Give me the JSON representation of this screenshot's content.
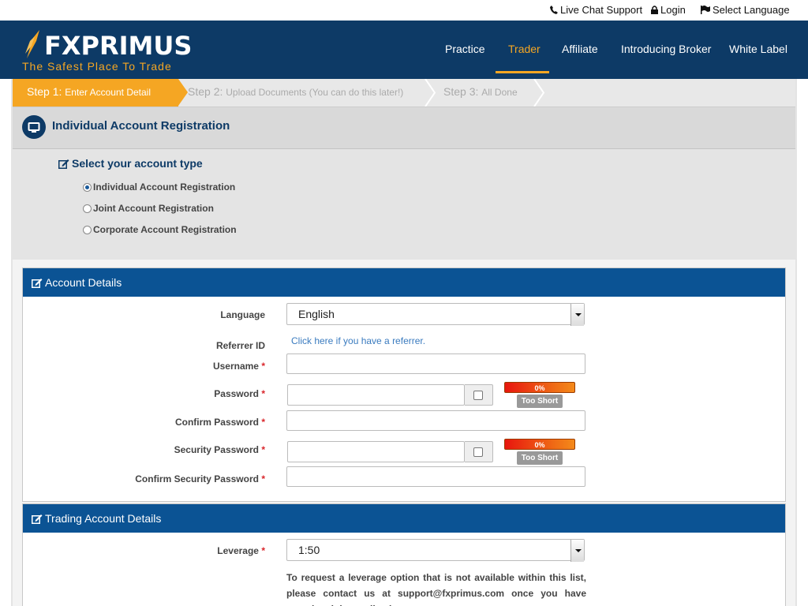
{
  "topbar": {
    "live_chat": "Live Chat Support",
    "login": "Login",
    "select_language": "Select Language"
  },
  "brand": {
    "name": "FXPRIMUS",
    "tagline": "The Safest Place To Trade",
    "accent_color": "#f5a623",
    "primary_color": "#0d3a66"
  },
  "nav": {
    "items": [
      "Practice",
      "Trader",
      "Affiliate",
      "Introducing Broker",
      "White Label"
    ],
    "active": "Trader"
  },
  "steps": [
    {
      "num": "Step 1:",
      "label": "Enter Account Detail",
      "state": "active"
    },
    {
      "num": "Step 2:",
      "label": "Upload Documents (You can do this later!)",
      "state": "pending"
    },
    {
      "num": "Step 3:",
      "label": "All Done",
      "state": "pending"
    }
  ],
  "section": {
    "title": "Individual Account Registration",
    "icon": "monitor-icon"
  },
  "account_type": {
    "title": "Select your account type",
    "options": [
      {
        "label": "Individual Account Registration",
        "checked": true
      },
      {
        "label": "Joint Account Registration",
        "checked": false
      },
      {
        "label": "Corporate Account Registration",
        "checked": false
      }
    ]
  },
  "account_details": {
    "title": "Account Details",
    "language_label": "Language",
    "language_value": "English",
    "referrer_label": "Referrer ID",
    "referrer_link": "Click here if you have a referrer.",
    "username_label": "Username",
    "password_label": "Password",
    "confirm_password_label": "Confirm Password",
    "security_password_label": "Security Password",
    "confirm_security_password_label": "Confirm Security Password",
    "required_mark": "*",
    "strength_value": "0%",
    "strength_text": "Too Short"
  },
  "trading_details": {
    "title": "Trading Account Details",
    "leverage_label": "Leverage",
    "leverage_value": "1:50",
    "note": "To request a leverage option that is not available within this list, please contact us at support@fxprimus.com once you have completed the application."
  }
}
